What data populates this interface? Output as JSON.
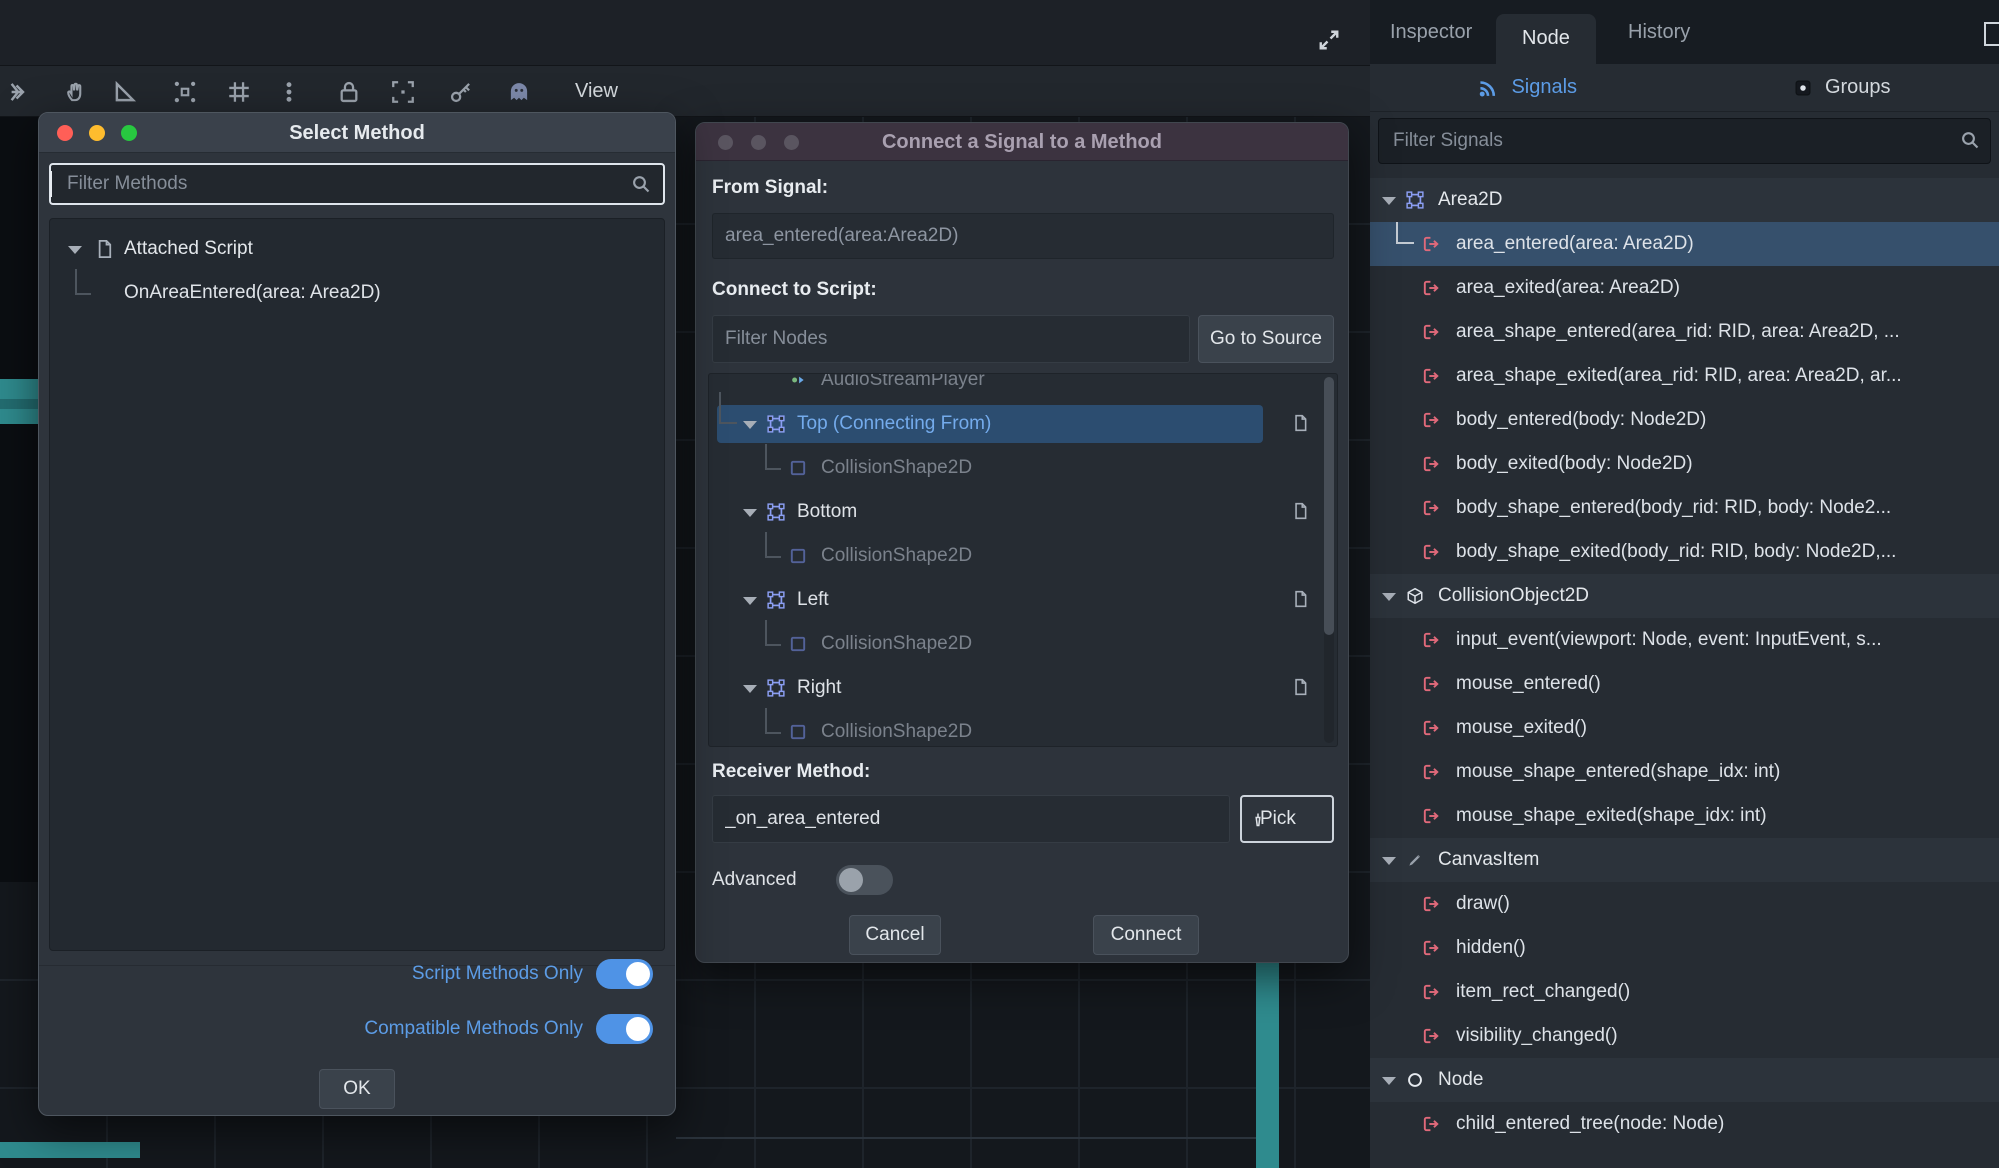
{
  "colors": {
    "accent_blue": "#5c9ce6",
    "signal_icon_red": "#e0697a",
    "selection_bg": "#36506c",
    "toggle_on_blue": "#4f93e6",
    "teal_accent": "#2f8b8e",
    "traffic_lights": [
      "#ff5f57",
      "#febc2e",
      "#28c840"
    ]
  },
  "topbar": {
    "fullscreen_icon": "expand-icon"
  },
  "toolbar": {
    "view_label": "View",
    "icons": [
      "node-select-icon",
      "pan-hand-icon",
      "ruler-icon",
      "smart-snap-icon",
      "grid-snap-icon",
      "more-options-icon",
      "lock-icon",
      "pixel-snap-icon",
      "key-icon",
      "sprite-icon"
    ]
  },
  "select_method_dialog": {
    "title": "Select Method",
    "filter_placeholder": "Filter Methods",
    "tree": {
      "parent": "Attached Script",
      "child": "OnAreaEntered(area: Area2D)"
    },
    "toggles": [
      {
        "label": "Script Methods Only",
        "on": true
      },
      {
        "label": "Compatible Methods Only",
        "on": true
      }
    ],
    "ok_label": "OK"
  },
  "connect_dialog": {
    "title": "Connect a Signal to a Method",
    "from_signal_label": "From Signal:",
    "from_signal_value": "area_entered(area:Area2D)",
    "connect_to_script_label": "Connect to Script:",
    "filter_nodes_placeholder": "Filter Nodes",
    "go_to_source_label": "Go to Source",
    "tree": [
      {
        "type": "clipped",
        "label": "AudioStreamPlayer"
      },
      {
        "type": "selected",
        "label": "Top (Connecting From)",
        "script": true,
        "selected": true
      },
      {
        "type": "child",
        "label": "CollisionShape2D"
      },
      {
        "type": "node",
        "label": "Bottom",
        "script": true
      },
      {
        "type": "child",
        "label": "CollisionShape2D"
      },
      {
        "type": "node",
        "label": "Left",
        "script": true
      },
      {
        "type": "child",
        "label": "CollisionShape2D"
      },
      {
        "type": "node",
        "label": "Right",
        "script": true
      },
      {
        "type": "child",
        "label": "CollisionShape2D"
      }
    ],
    "receiver_method_label": "Receiver Method:",
    "receiver_method_value": "_on_area_entered",
    "pick_label": "Pick",
    "advanced_label": "Advanced",
    "cancel_label": "Cancel",
    "connect_label": "Connect"
  },
  "node_dock": {
    "tabs": [
      "Inspector",
      "Node",
      "History"
    ],
    "active_tab": "Node",
    "signals_label": "Signals",
    "groups_label": "Groups",
    "filter_placeholder": "Filter Signals",
    "rows": [
      {
        "type": "category",
        "icon": "area2d",
        "label": "Area2D"
      },
      {
        "type": "signal",
        "label": "area_entered(area: Area2D)",
        "selected": true
      },
      {
        "type": "signal",
        "label": "area_exited(area: Area2D)"
      },
      {
        "type": "signal",
        "label": "area_shape_entered(area_rid: RID, area: Area2D, ..."
      },
      {
        "type": "signal",
        "label": "area_shape_exited(area_rid: RID, area: Area2D, ar..."
      },
      {
        "type": "signal",
        "label": "body_entered(body: Node2D)"
      },
      {
        "type": "signal",
        "label": "body_exited(body: Node2D)"
      },
      {
        "type": "signal",
        "label": "body_shape_entered(body_rid: RID, body: Node2..."
      },
      {
        "type": "signal",
        "label": "body_shape_exited(body_rid: RID, body: Node2D,..."
      },
      {
        "type": "category",
        "icon": "collisionobject2d",
        "label": "CollisionObject2D"
      },
      {
        "type": "signal",
        "label": "input_event(viewport: Node, event: InputEvent, s..."
      },
      {
        "type": "signal",
        "label": "mouse_entered()"
      },
      {
        "type": "signal",
        "label": "mouse_exited()"
      },
      {
        "type": "signal",
        "label": "mouse_shape_entered(shape_idx: int)"
      },
      {
        "type": "signal",
        "label": "mouse_shape_exited(shape_idx: int)"
      },
      {
        "type": "category",
        "icon": "canvasitem",
        "label": "CanvasItem"
      },
      {
        "type": "signal",
        "label": "draw()"
      },
      {
        "type": "signal",
        "label": "hidden()"
      },
      {
        "type": "signal",
        "label": "item_rect_changed()"
      },
      {
        "type": "signal",
        "label": "visibility_changed()"
      },
      {
        "type": "category",
        "icon": "node",
        "label": "Node"
      },
      {
        "type": "signal",
        "label": "child_entered_tree(node: Node)"
      }
    ]
  }
}
